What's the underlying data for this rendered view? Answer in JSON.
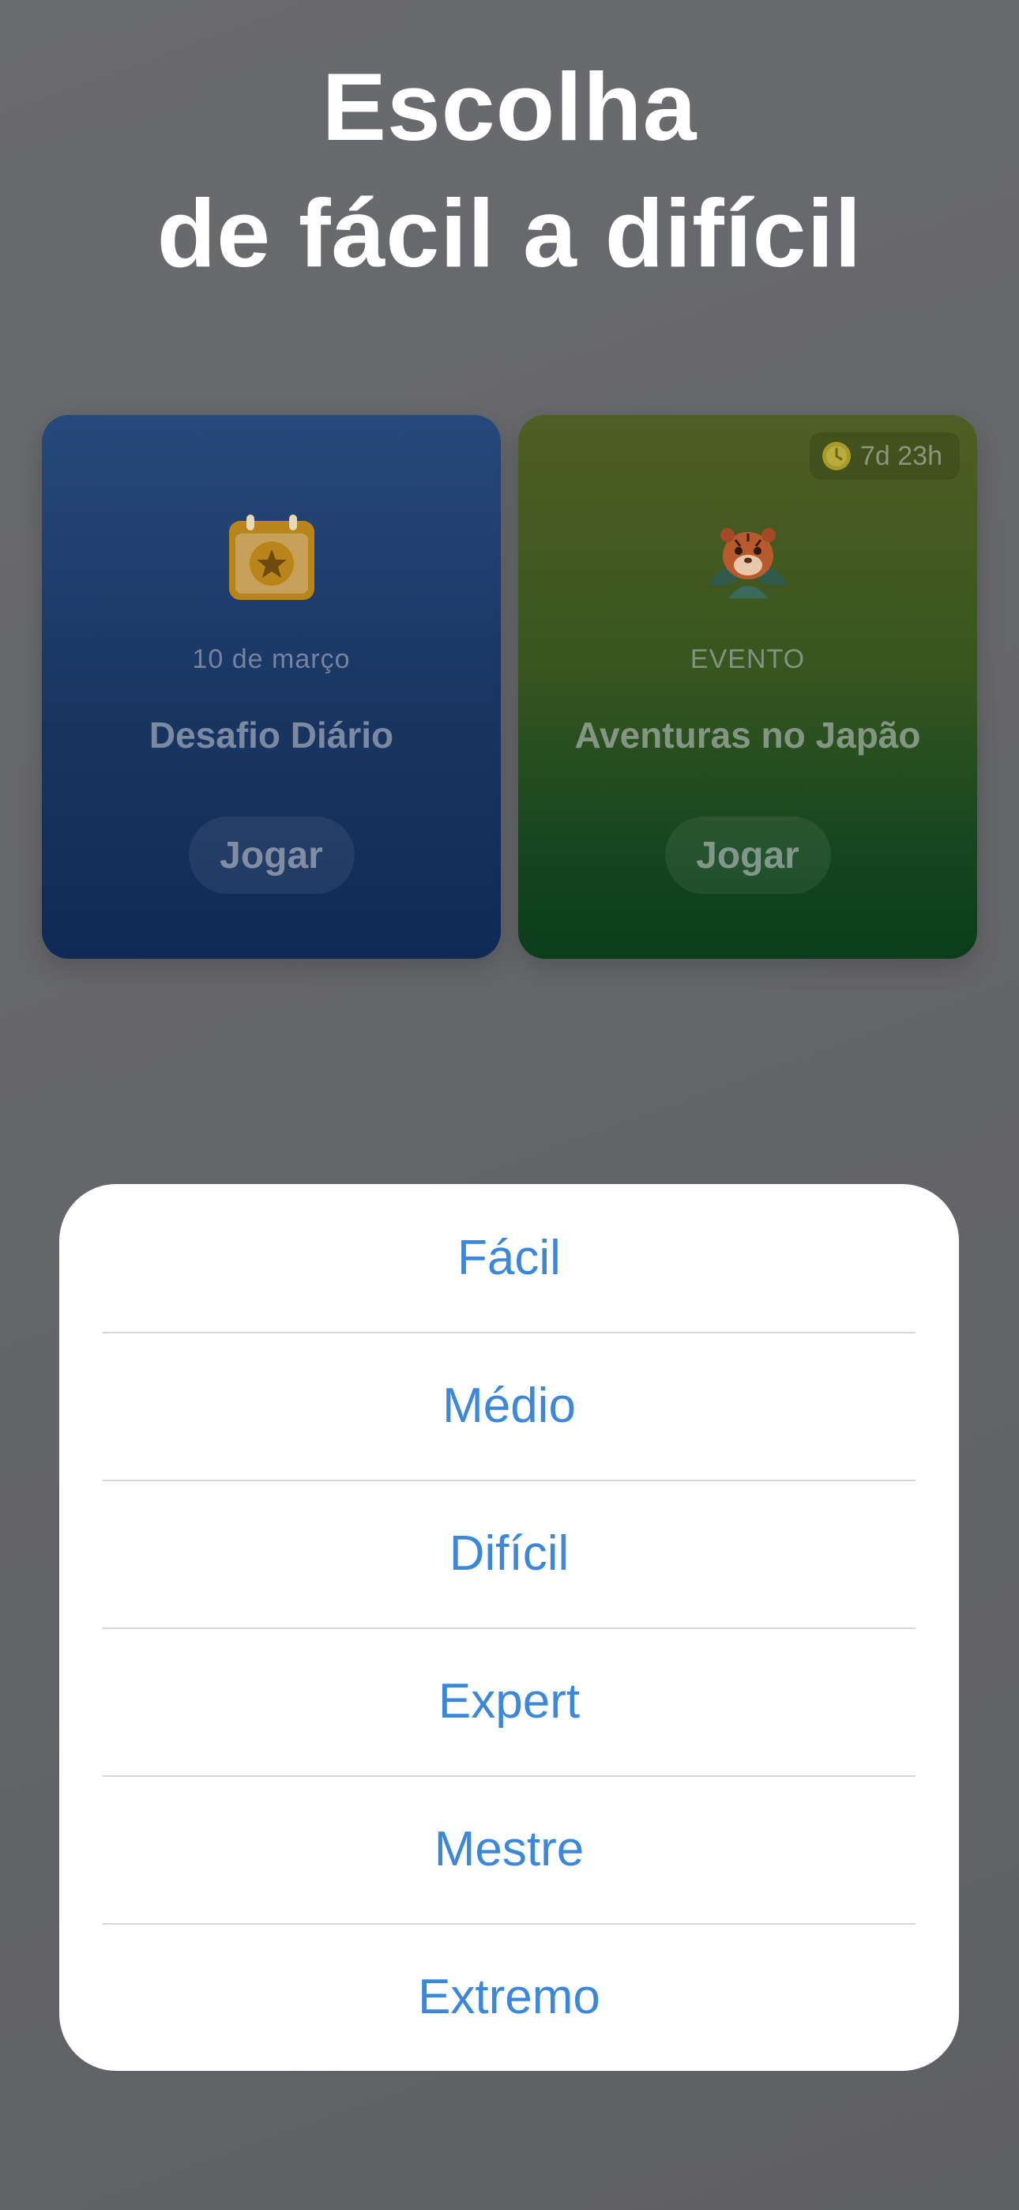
{
  "heading": {
    "line1": "Escolha",
    "line2": "de fácil a difícil"
  },
  "cards": {
    "daily": {
      "icon": "calendar-star-icon",
      "subtitle": "10 de março",
      "title": "Desafio Diário",
      "button": "Jogar",
      "color": "#1a3764"
    },
    "event": {
      "icon": "tiger-icon",
      "timer": "7d 23h",
      "subtitle": "EVENTO",
      "title": "Aventuras no Japão",
      "button": "Jogar",
      "color": "#2c5222"
    }
  },
  "difficulty_sheet": {
    "accent": "#3b87d9",
    "options": [
      "Fácil",
      "Médio",
      "Difícil",
      "Expert",
      "Mestre",
      "Extremo"
    ]
  }
}
